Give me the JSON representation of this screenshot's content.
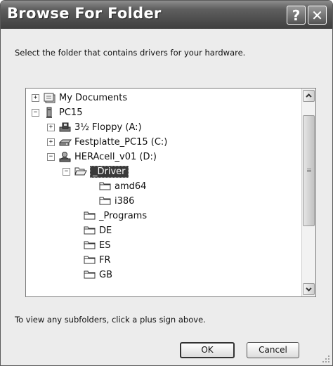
{
  "window": {
    "title": "Browse For Folder",
    "help_label": "?",
    "close_label": "✕"
  },
  "instruction": "Select the folder that contains drivers for your hardware.",
  "tree": {
    "items": [
      {
        "label": "My Documents",
        "expander": "+",
        "icon": "my-documents-icon"
      },
      {
        "label": "PC15",
        "expander": "−",
        "icon": "computer-icon"
      },
      {
        "label": "3½ Floppy (A:)",
        "expander": "+",
        "icon": "floppy-drive-icon"
      },
      {
        "label": "Festplatte_PC15 (C:)",
        "expander": "+",
        "icon": "hard-drive-icon"
      },
      {
        "label": "HERAcell_v01 (D:)",
        "expander": "−",
        "icon": "network-drive-icon"
      },
      {
        "label": "_Driver",
        "expander": "−",
        "icon": "open-folder-icon",
        "selected": true
      },
      {
        "label": "amd64",
        "icon": "folder-icon"
      },
      {
        "label": "i386",
        "icon": "folder-icon"
      },
      {
        "label": "_Programs",
        "icon": "folder-icon"
      },
      {
        "label": "DE",
        "icon": "folder-icon"
      },
      {
        "label": "ES",
        "icon": "folder-icon"
      },
      {
        "label": "FR",
        "icon": "folder-icon"
      },
      {
        "label": "GB",
        "icon": "folder-icon"
      }
    ]
  },
  "footer_text": "To view any subfolders, click a plus sign above.",
  "buttons": {
    "ok": "OK",
    "cancel": "Cancel"
  }
}
